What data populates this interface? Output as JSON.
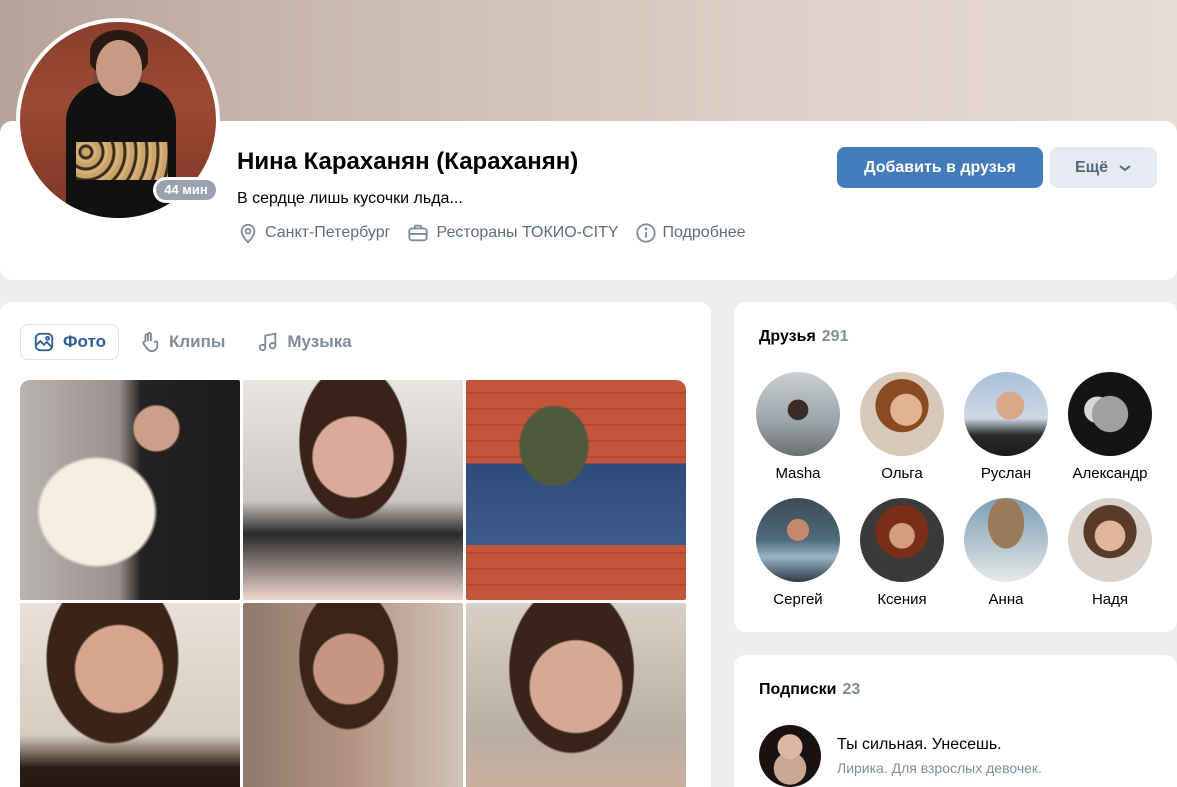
{
  "profile": {
    "name": "Нина Караханян (Караханян)",
    "status": "В сердце лишь кусочки льда...",
    "online": "44 мин",
    "info": {
      "city": "Санкт-Петербург",
      "work": "Рестораны ТОКИО-CITY",
      "more": "Подробнее"
    },
    "buttons": {
      "add_friend": "Добавить в друзья",
      "more": "Ещё"
    }
  },
  "media": {
    "tabs": [
      {
        "label": "Фото",
        "icon": "photo-icon",
        "active": true
      },
      {
        "label": "Клипы",
        "icon": "clips-icon",
        "active": false
      },
      {
        "label": "Музыка",
        "icon": "music-icon",
        "active": false
      }
    ]
  },
  "friends": {
    "title": "Друзья",
    "count": "291",
    "items": [
      {
        "name": "Masha"
      },
      {
        "name": "Ольга"
      },
      {
        "name": "Руслан"
      },
      {
        "name": "Александр"
      },
      {
        "name": "Сергей"
      },
      {
        "name": "Ксения"
      },
      {
        "name": "Анна"
      },
      {
        "name": "Надя"
      }
    ]
  },
  "subscriptions": {
    "title": "Подписки",
    "count": "23",
    "items": [
      {
        "name": "Ты сильная. Унесешь.",
        "description": "Лирика. Для взрослых девочек."
      }
    ]
  },
  "colors": {
    "accent": "#447bba",
    "background": "#edeef0",
    "secondary_text": "#818c99"
  }
}
